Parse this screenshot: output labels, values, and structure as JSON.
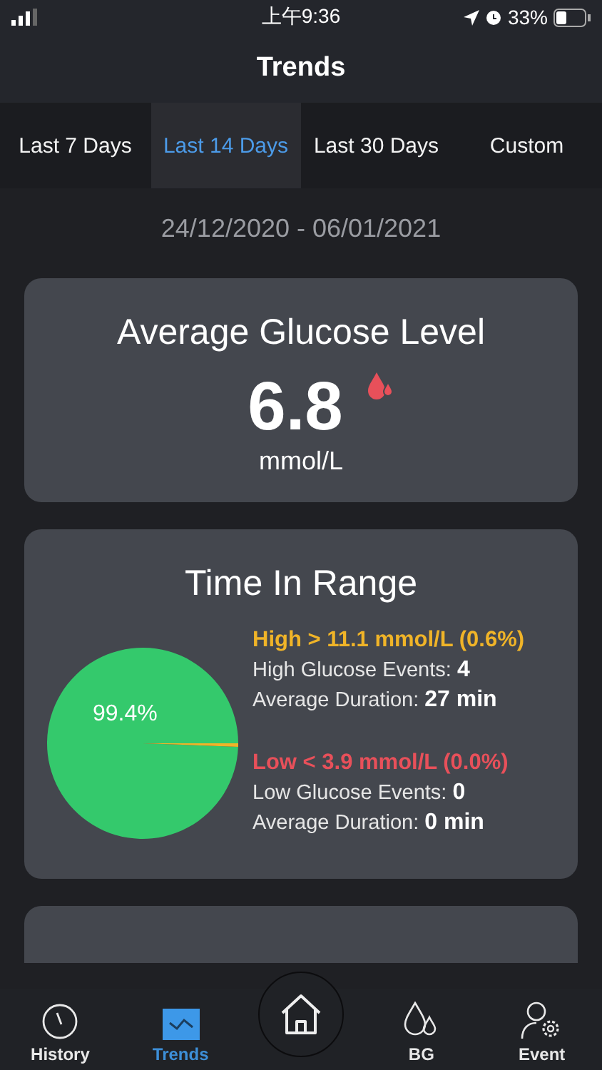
{
  "status_bar": {
    "time": "上午9:36",
    "battery": "33%"
  },
  "header": {
    "title": "Trends"
  },
  "tabs": [
    {
      "label": "Last 7 Days",
      "selected": false
    },
    {
      "label": "Last 14 Days",
      "selected": true
    },
    {
      "label": "Last 30 Days",
      "selected": false
    },
    {
      "label": "Custom",
      "selected": false
    }
  ],
  "date_range": "24/12/2020 - 06/01/2021",
  "average_card": {
    "title": "Average Glucose Level",
    "value": "6.8",
    "unit": "mmol/L"
  },
  "range_card": {
    "title": "Time In Range",
    "chart_data": {
      "type": "pie",
      "values": [
        99.4,
        0.6,
        0.0
      ]
    },
    "pie_label": "99.4%",
    "sections": [
      {
        "heading": "High > 11.1 mmol/L (0.6%)",
        "color": "#f0b428",
        "lines": [
          {
            "label": "High Glucose Events:",
            "value": "4"
          },
          {
            "label": "Average Duration:",
            "value": "27 min"
          }
        ]
      },
      {
        "heading": "Low < 3.9 mmol/L (0.0%)",
        "color": "#e8505a",
        "lines": [
          {
            "label": "Low Glucose Events:",
            "value": "0"
          },
          {
            "label": "Average Duration:",
            "value": "0 min"
          }
        ]
      }
    ]
  },
  "tab_bar": [
    {
      "label": "History",
      "kind": "history",
      "selected": false
    },
    {
      "label": "Trends",
      "kind": "trends",
      "selected": true
    },
    {
      "kind": "home",
      "selected": false
    },
    {
      "label": "BG",
      "kind": "bg",
      "selected": false
    },
    {
      "label": "Event",
      "kind": "event",
      "selected": false
    }
  ]
}
